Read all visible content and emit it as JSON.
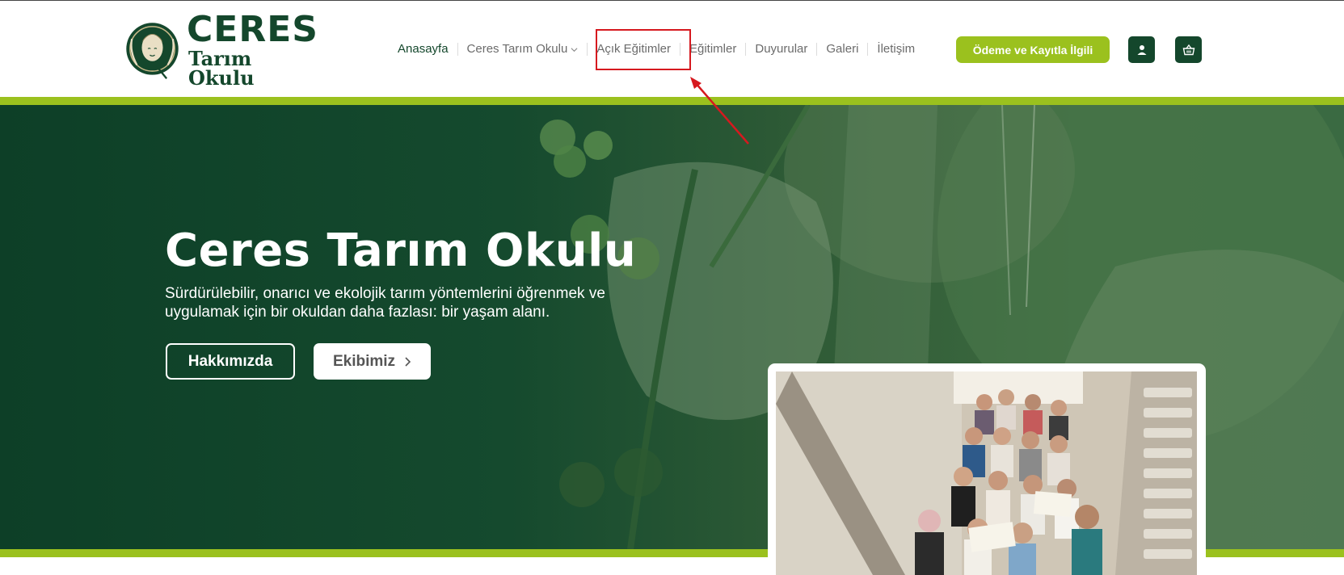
{
  "header": {
    "logo": {
      "title": "CERES",
      "subtitle": "Tarım Okulu"
    },
    "nav": [
      {
        "label": "Anasayfa"
      },
      {
        "label": "Ceres Tarım Okulu"
      },
      {
        "label": "Açık Eğitimler"
      },
      {
        "label": "Eğitimler"
      },
      {
        "label": "Duyurular"
      },
      {
        "label": "Galeri"
      },
      {
        "label": "İletişim"
      }
    ],
    "cta_label": "Ödeme ve Kayıtla İlgili",
    "icons": [
      "user-icon",
      "basket-icon"
    ]
  },
  "hero": {
    "title": "Ceres Tarım Okulu",
    "subtitle": "Sürdürülebilir, onarıcı ve ekolojik tarım yöntemlerini öğrenmek ve uygulamak için bir okuldan daha fazlası: bir yaşam alanı.",
    "buttons": [
      {
        "label": "Hakkımızda"
      },
      {
        "label": "Ekibimiz"
      }
    ]
  },
  "colors": {
    "brand_dark_green": "#14472c",
    "accent_lime": "#9bc11e",
    "annotation_red": "#d6191f"
  }
}
